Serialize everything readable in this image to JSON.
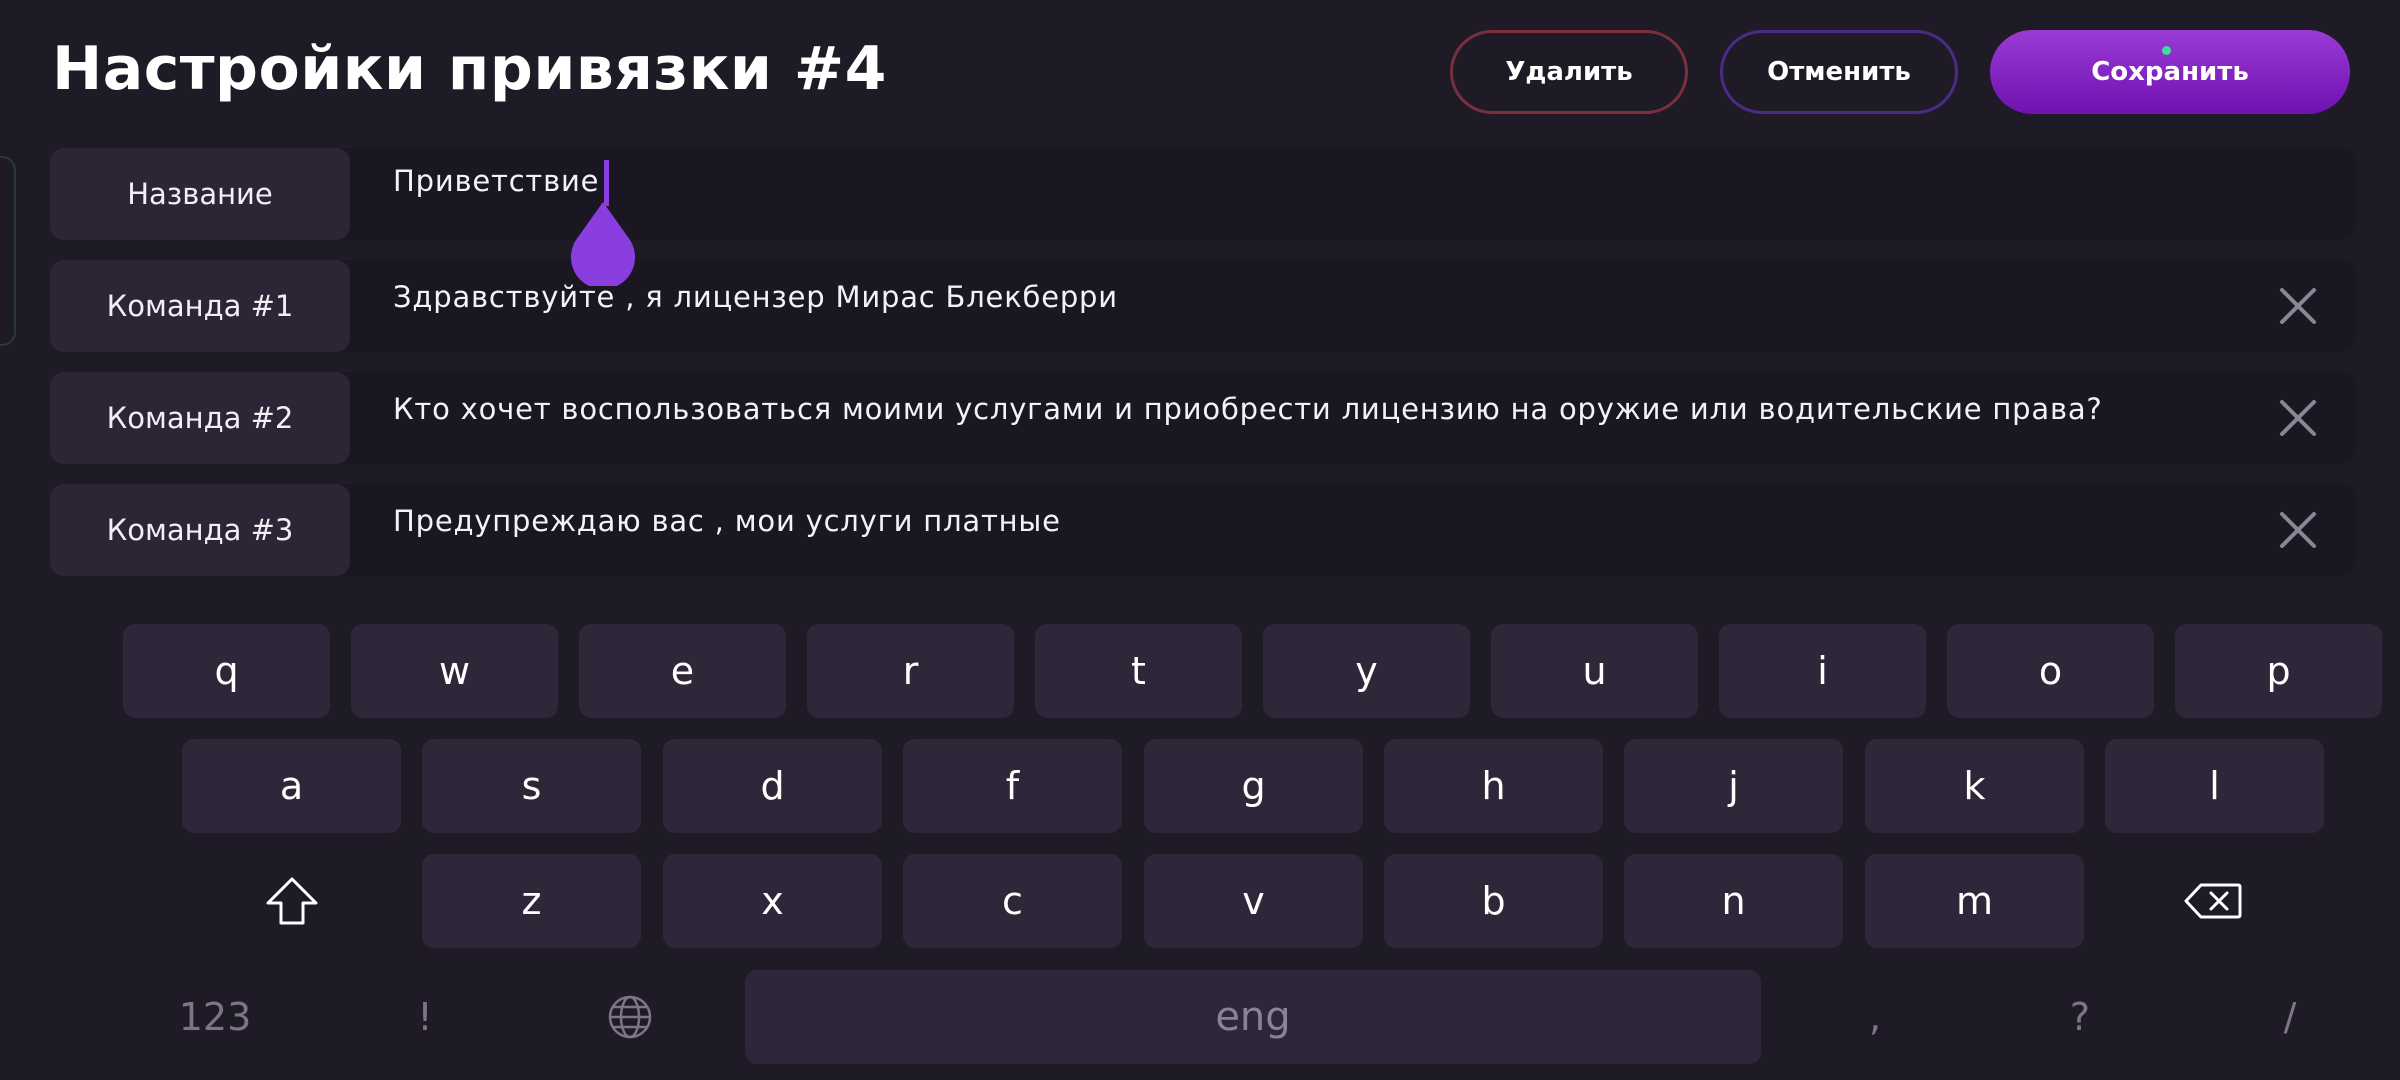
{
  "header": {
    "title": "Настройки привязки #4",
    "delete_label": "Удалить",
    "cancel_label": "Отменить",
    "save_label": "Сохранить"
  },
  "fields": [
    {
      "label": "Название",
      "value": "Приветствие"
    },
    {
      "label": "Команда #1",
      "value": "Здравствуйте , я лицензер Мирас Блекберри"
    },
    {
      "label": "Команда #2",
      "value": "Кто хочет воспользоваться моими услугами и приобрести лицензию на оружие или водительские права?"
    },
    {
      "label": "Команда #3",
      "value": "Предупреждаю вас , мои услуги платные"
    }
  ],
  "keyboard": {
    "row1": [
      "q",
      "w",
      "e",
      "r",
      "t",
      "y",
      "u",
      "i",
      "o",
      "p"
    ],
    "row2": [
      "a",
      "s",
      "d",
      "f",
      "g",
      "h",
      "j",
      "k",
      "l"
    ],
    "row3": [
      "z",
      "x",
      "c",
      "v",
      "b",
      "n",
      "m"
    ],
    "row4": {
      "numbers": "123",
      "exclaim": "!",
      "space": "eng",
      "comma": ",",
      "question": "?",
      "slash": "/"
    },
    "icons": {
      "shift": "shift-icon",
      "backspace": "backspace-icon",
      "language": "globe-icon"
    }
  },
  "colors": {
    "background": "#1e1a26",
    "accent": "#8a3ee0",
    "delete_border": "#7a2f3e",
    "cancel_border": "#4c2a85"
  }
}
